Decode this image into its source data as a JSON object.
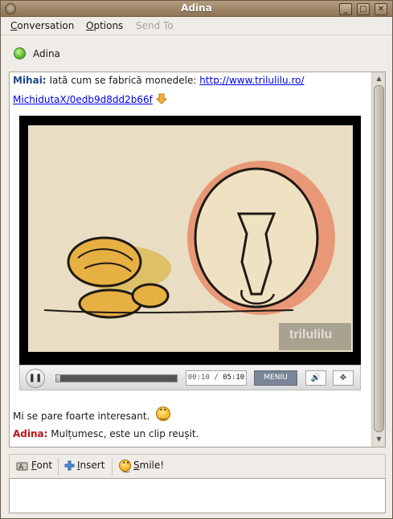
{
  "window": {
    "title": "Adina"
  },
  "menu": {
    "conversation": "onversation",
    "conversation_key": "C",
    "options": "ptions",
    "options_key": "O",
    "send_to": "Send To"
  },
  "contact": {
    "name": "Adina",
    "status": "online"
  },
  "messages": [
    {
      "nick": "Mihai:",
      "text": "Iată cum se fabrică monedele: ",
      "link_part1": "http://www.trilulilu.ro/",
      "link_part2": "MichidutaX/0edb9d8dd2b66f"
    },
    {
      "nick": "",
      "text": "Mi se pare foarte interesant."
    },
    {
      "nick": "Adina:",
      "text": "Mulțumesc, este un clip reușit."
    }
  ],
  "video": {
    "time_current": "00:10",
    "time_total": "05:10",
    "progress": 0.03,
    "menu_label": "MENIU",
    "watermark": "trilulilu"
  },
  "toolbar": {
    "font_key": "F",
    "font_rest": "ont",
    "insert_key": "I",
    "insert_rest": "nsert",
    "smile_key": "S",
    "smile_rest": "mile!"
  },
  "colors": {
    "nick_mihai": "#1e4a8a",
    "nick_adina": "#b81818",
    "status_online": "#5cb82b"
  },
  "icons": {
    "status": "green-dot-icon",
    "arrow": "arrow-down-icon",
    "smiley": "smiley-icon",
    "font": "font-icon",
    "insert": "plus-icon"
  }
}
